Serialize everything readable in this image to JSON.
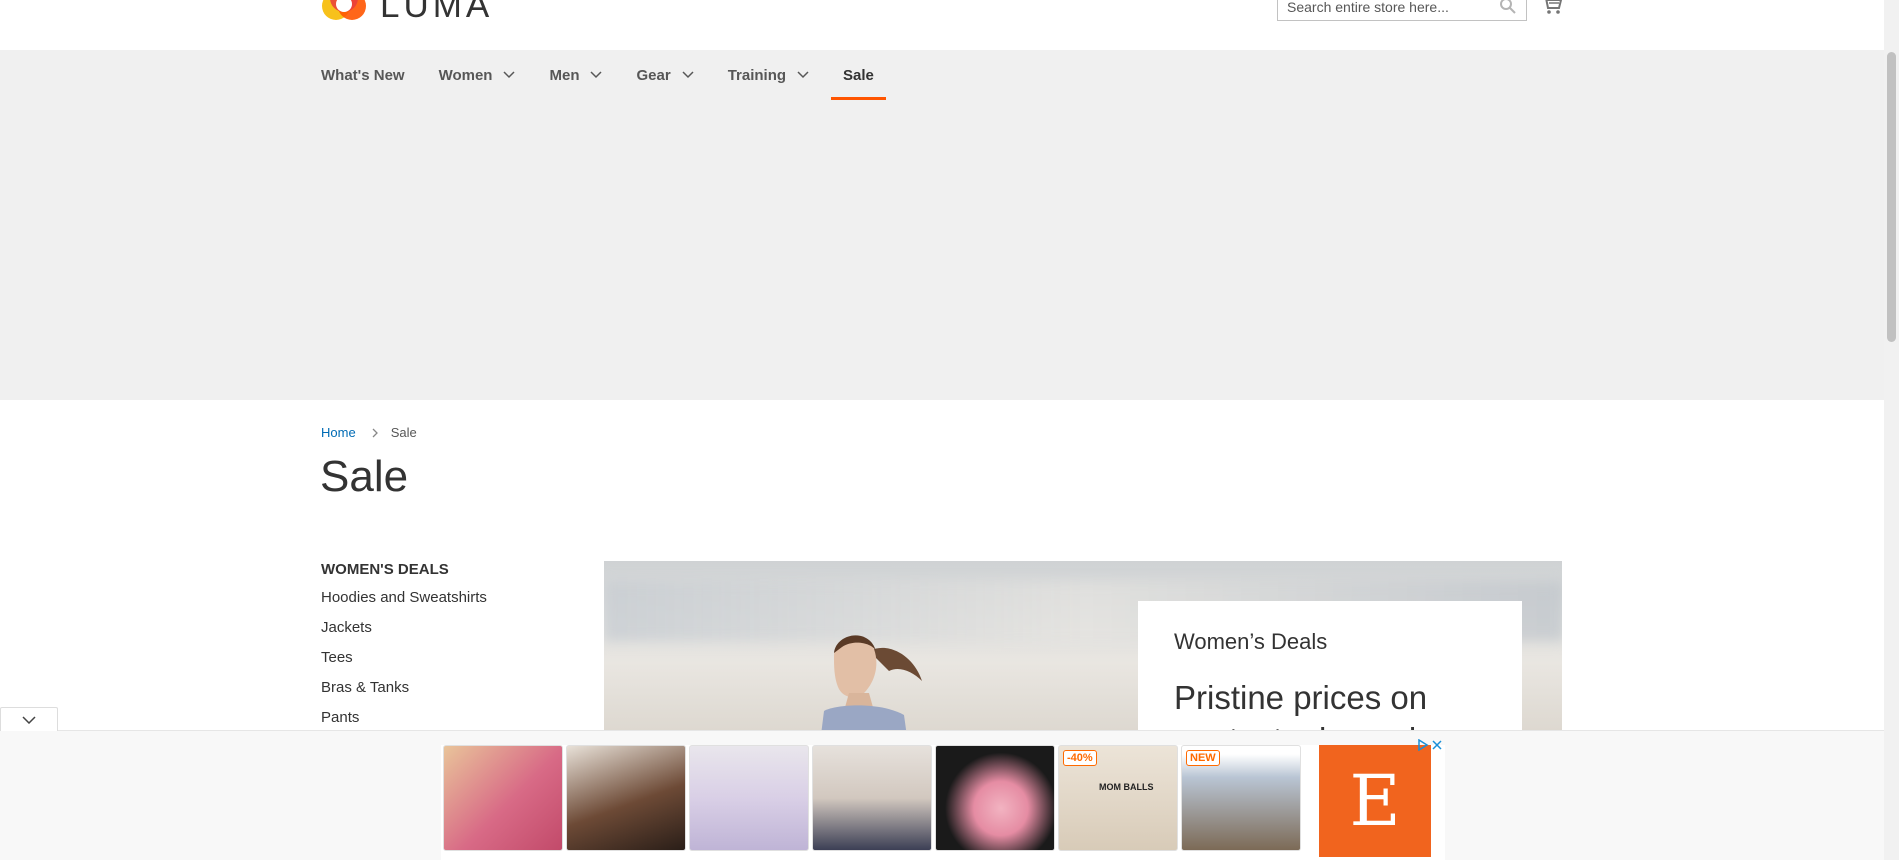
{
  "header": {
    "logo_text": "LUMA",
    "search_placeholder": "Search entire store here..."
  },
  "nav": {
    "items": [
      {
        "label": "What's New",
        "has_dropdown": false
      },
      {
        "label": "Women",
        "has_dropdown": true
      },
      {
        "label": "Men",
        "has_dropdown": true
      },
      {
        "label": "Gear",
        "has_dropdown": true
      },
      {
        "label": "Training",
        "has_dropdown": true
      },
      {
        "label": "Sale",
        "has_dropdown": false,
        "active": true
      }
    ]
  },
  "breadcrumb": {
    "home": "Home",
    "current": "Sale"
  },
  "page_title": "Sale",
  "sidebar": {
    "heading": "WOMEN'S DEALS",
    "links": [
      "Hoodies and Sweatshirts",
      "Jackets",
      "Tees",
      "Bras & Tanks",
      "Pants"
    ]
  },
  "hero": {
    "subtitle": "Women’s Deals",
    "title": "Pristine prices on pants, tanks and"
  },
  "ad": {
    "badges": [
      "-40%",
      "NEW"
    ],
    "etsy_letter": "E",
    "thumb_labels": [
      "MOM BALLS"
    ]
  },
  "colors": {
    "accent": "#ff5501",
    "link": "#006bb4",
    "nav_bg": "#f0f0f0",
    "etsy": "#f1641e"
  }
}
